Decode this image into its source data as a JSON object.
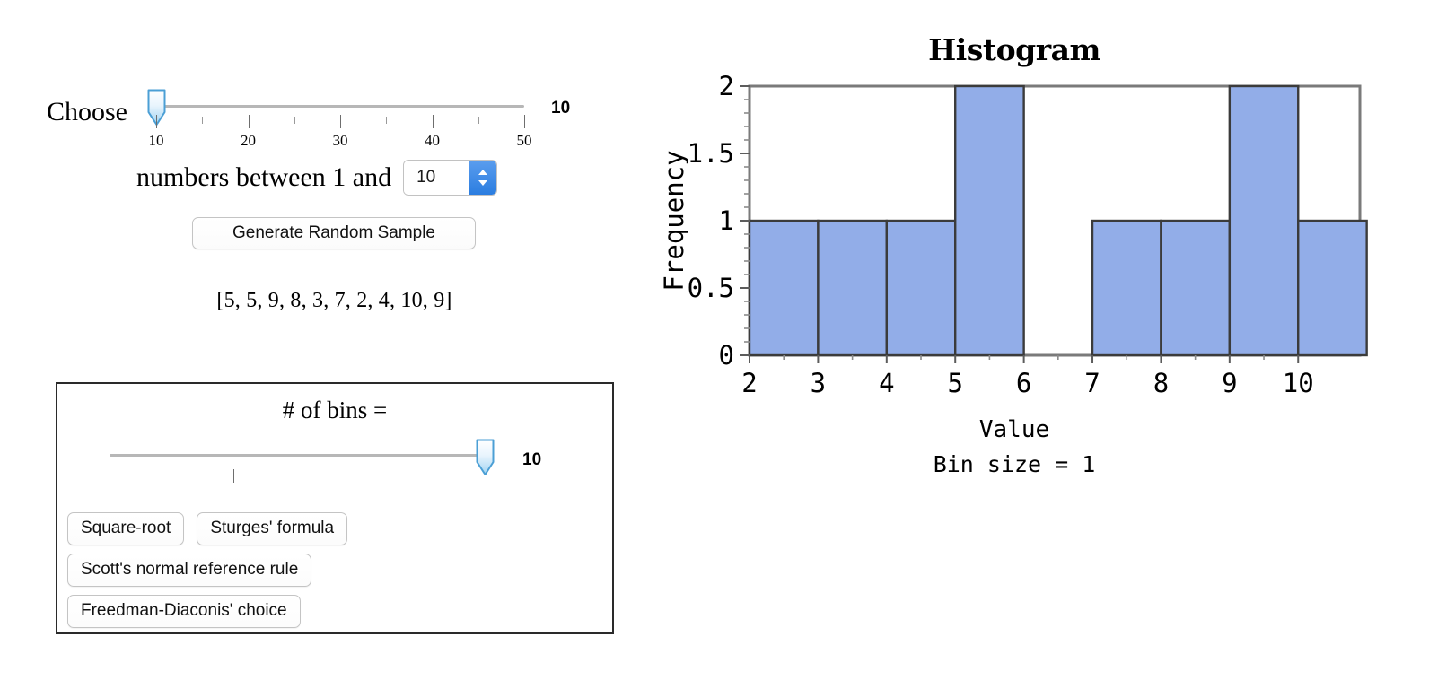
{
  "controls": {
    "choose_label": "Choose",
    "sample_slider": {
      "name": "sample-size-slider",
      "value": 10,
      "value_display": "10",
      "min": 10,
      "max": 50,
      "major_ticks": [
        10,
        20,
        30,
        40,
        50
      ],
      "major_tick_labels": [
        "10",
        "20",
        "30",
        "40",
        "50"
      ],
      "minor_ticks": [
        15,
        25,
        35,
        45
      ]
    },
    "between_label": "numbers between 1 and",
    "max_value_stepper": {
      "name": "max-value-stepper",
      "value": "10"
    },
    "generate_button_label": "Generate Random Sample",
    "sample_display": "[5, 5, 9, 8, 3, 7, 2, 4, 10, 9]"
  },
  "sample": {
    "values": [
      5,
      5,
      9,
      8,
      3,
      7,
      2,
      4,
      10,
      9
    ]
  },
  "bins_panel": {
    "title": "# of bins =",
    "bins_slider": {
      "name": "bins-slider",
      "value": 10,
      "value_display": "10",
      "fraction": 1.0,
      "tick_fractions": [
        0.0,
        0.33
      ]
    },
    "rule_buttons": [
      {
        "label": "Square-root",
        "row": 0
      },
      {
        "label": "Sturges' formula",
        "row": 0
      },
      {
        "label": "Scott's normal reference rule",
        "row": 1
      },
      {
        "label": "Freedman-Diaconis' choice",
        "row": 2
      }
    ]
  },
  "chart_data": {
    "type": "bar",
    "title": "Histogram",
    "xlabel": "Value",
    "ylabel": "Frequency",
    "caption": "Bin size = 1",
    "bin_size": 1,
    "bin_edges": [
      2,
      3,
      4,
      5,
      6,
      7,
      8,
      9,
      10,
      11
    ],
    "categories": [
      "2-3",
      "3-4",
      "4-5",
      "5-6",
      "6-7",
      "7-8",
      "8-9",
      "9-10",
      "10-11"
    ],
    "values": [
      1,
      1,
      1,
      2,
      0,
      1,
      1,
      2,
      1
    ],
    "xlim": [
      2,
      10.9
    ],
    "ylim": [
      0,
      2
    ],
    "x_ticks": [
      2,
      3,
      4,
      5,
      6,
      7,
      8,
      9,
      10
    ],
    "x_tick_labels": [
      "2",
      "3",
      "4",
      "5",
      "6",
      "7",
      "8",
      "9",
      "10"
    ],
    "y_ticks": [
      0,
      0.5,
      1,
      1.5,
      2
    ],
    "y_tick_labels": [
      "0",
      "0.5",
      "1",
      "1.5",
      "2"
    ],
    "y_minor_ticks": [
      0.1,
      0.2,
      0.3,
      0.4,
      0.6,
      0.7,
      0.8,
      0.9,
      1.1,
      1.2,
      1.3,
      1.4,
      1.6,
      1.7,
      1.8,
      1.9
    ],
    "grid": false,
    "legend": false,
    "bar_color": "#92ade8",
    "bar_edge_color": "#3b3b3b",
    "frame_color": "#7a7a7a"
  }
}
